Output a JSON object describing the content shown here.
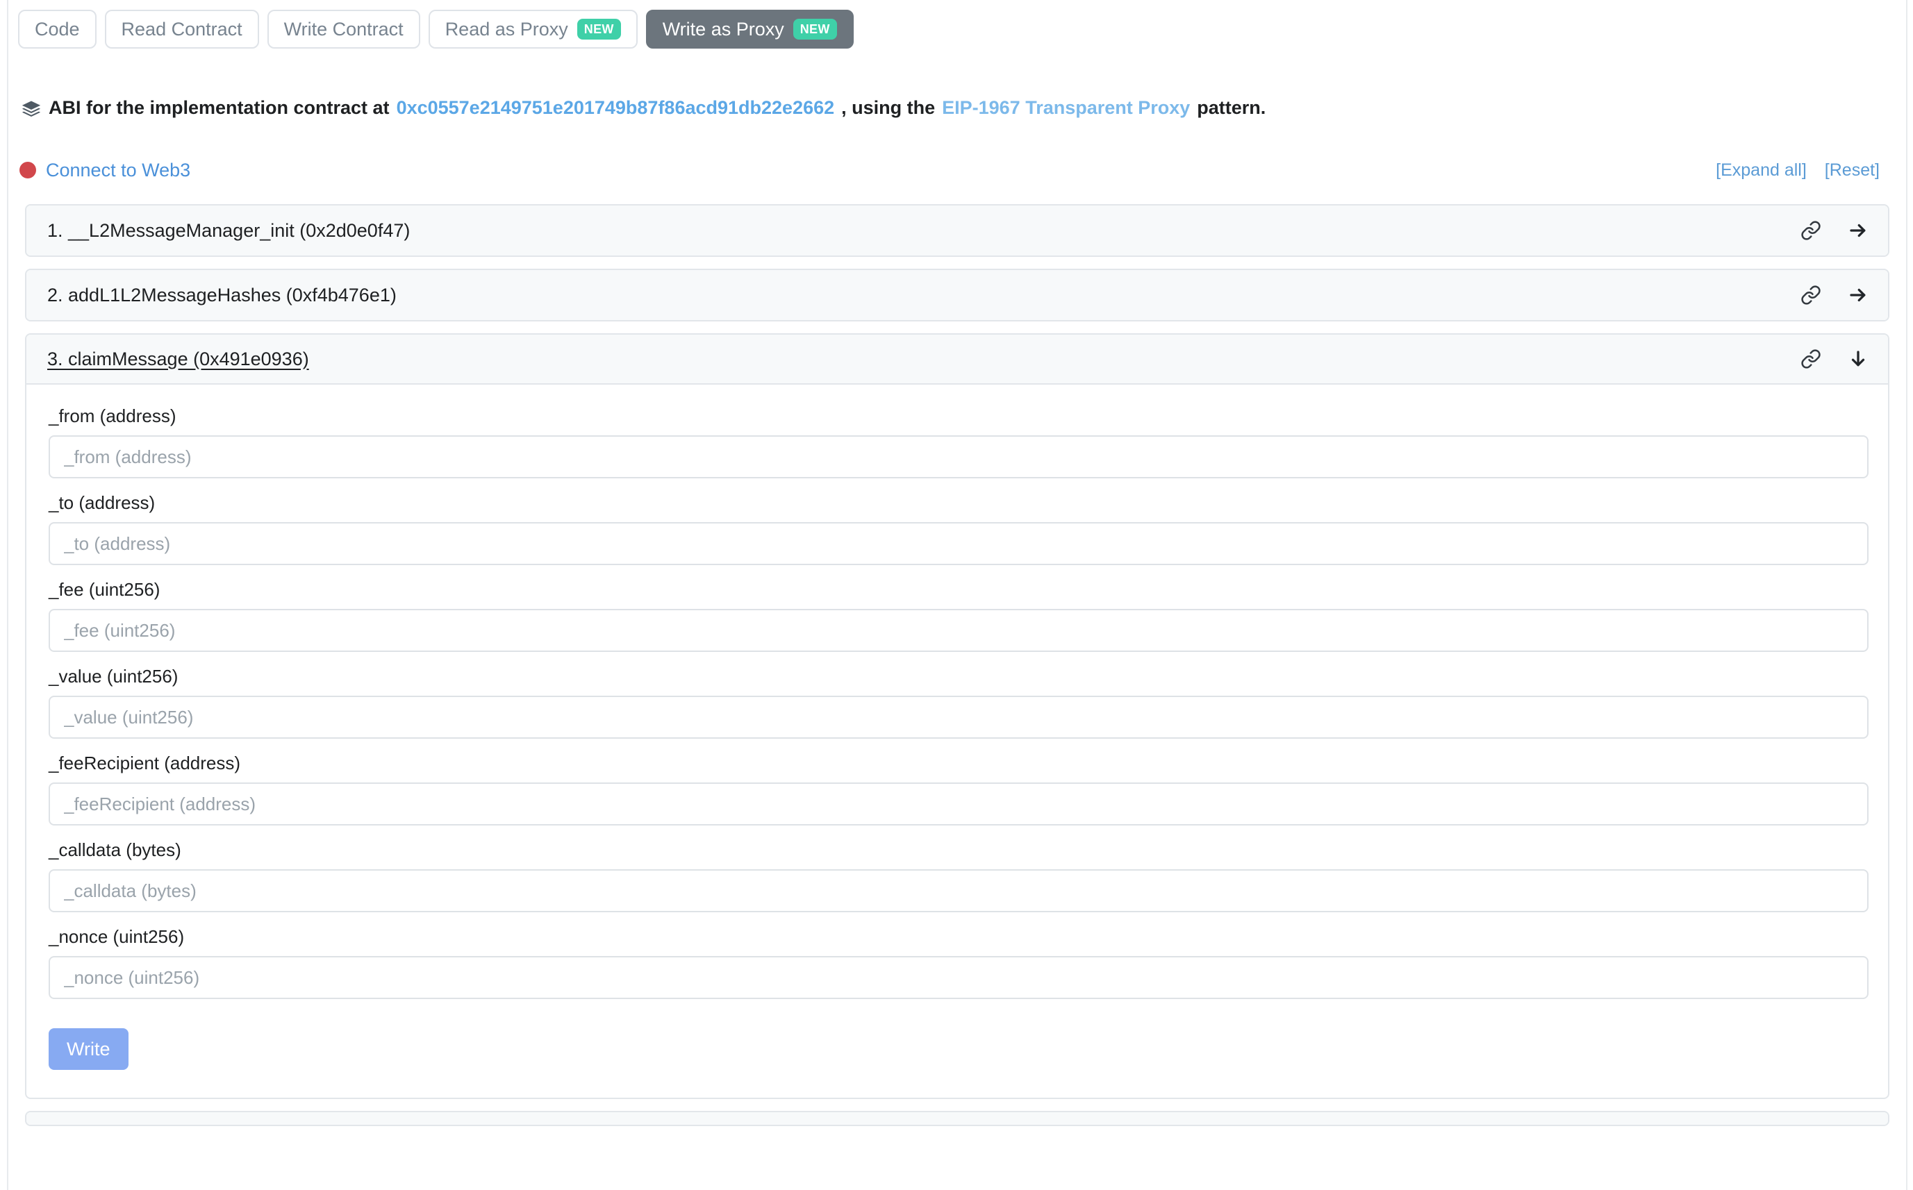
{
  "tabs": [
    {
      "label": "Code",
      "badge": null,
      "active": false
    },
    {
      "label": "Read Contract",
      "badge": null,
      "active": false
    },
    {
      "label": "Write Contract",
      "badge": null,
      "active": false
    },
    {
      "label": "Read as Proxy",
      "badge": "NEW",
      "active": false
    },
    {
      "label": "Write as Proxy",
      "badge": "NEW",
      "active": true
    }
  ],
  "abi_notice": {
    "icon": "layers-icon",
    "prefix": "ABI for the implementation contract at ",
    "address": "0xc0557e2149751e201749b87f86acd91db22e2662",
    "middle": ", using the ",
    "pattern_link": "EIP-1967 Transparent Proxy",
    "suffix": " pattern."
  },
  "connect": {
    "status_color": "#d1474b",
    "label": "Connect to Web3",
    "expand_all": "[Expand all]",
    "reset": "[Reset]"
  },
  "functions": [
    {
      "title": "1. __L2MessageManager_init (0x2d0e0f47)",
      "expanded": false,
      "toggle_icon": "arrow-right-icon"
    },
    {
      "title": "2. addL1L2MessageHashes (0xf4b476e1)",
      "expanded": false,
      "toggle_icon": "arrow-right-icon"
    },
    {
      "title": "3. claimMessage (0x491e0936)",
      "expanded": true,
      "toggle_icon": "arrow-down-icon",
      "fields": [
        {
          "label": "_from (address)",
          "placeholder": "_from (address)",
          "value": ""
        },
        {
          "label": "_to (address)",
          "placeholder": "_to (address)",
          "value": ""
        },
        {
          "label": "_fee (uint256)",
          "placeholder": "_fee (uint256)",
          "value": ""
        },
        {
          "label": "_value (uint256)",
          "placeholder": "_value (uint256)",
          "value": ""
        },
        {
          "label": "_feeRecipient (address)",
          "placeholder": "_feeRecipient (address)",
          "value": ""
        },
        {
          "label": "_calldata (bytes)",
          "placeholder": "_calldata (bytes)",
          "value": ""
        },
        {
          "label": "_nonce (uint256)",
          "placeholder": "_nonce (uint256)",
          "value": ""
        }
      ],
      "submit_label": "Write"
    }
  ],
  "colors": {
    "accent_link": "#5ba7e6",
    "active_tab_bg": "#6c757d",
    "badge_new": "#3fd0a8",
    "status_red": "#d1474b",
    "write_button": "#87aaf2",
    "card_header_bg": "#f7f9fa",
    "border": "#e2e6ea"
  }
}
